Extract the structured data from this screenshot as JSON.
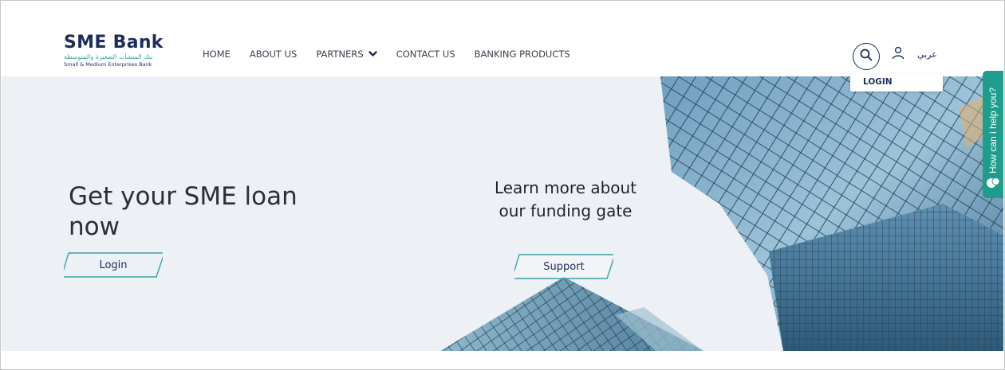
{
  "header": {
    "logo": {
      "name": "SME Bank",
      "arabic_tagline": "بنك المنشآت الصغيرة والمتوسطة",
      "english_tagline": "Small & Medium Enterprises Bank"
    },
    "nav": [
      {
        "label": "HOME"
      },
      {
        "label": "ABOUT US"
      },
      {
        "label": "PARTNERS",
        "has_dropdown": true
      },
      {
        "label": "CONTACT US"
      },
      {
        "label": "BANKING PRODUCTS"
      }
    ],
    "language_toggle": "عربي",
    "login_popup_label": "LOGIN",
    "icons": {
      "search": "search-icon",
      "user": "user-icon",
      "dropdown": "chevron-down-icon"
    }
  },
  "hero": {
    "headline": "Get your SME loan now",
    "login_button": "Login",
    "learn_more_text": "Learn more about our funding gate",
    "support_button": "Support"
  },
  "help_tab": {
    "label": "How can i help you?",
    "icon": "chat-icon",
    "color": "#1f9d8c"
  },
  "colors": {
    "brand_navy": "#1d2c5c",
    "accent_teal": "#3aa3a7",
    "hero_background": "#edf0f4"
  }
}
